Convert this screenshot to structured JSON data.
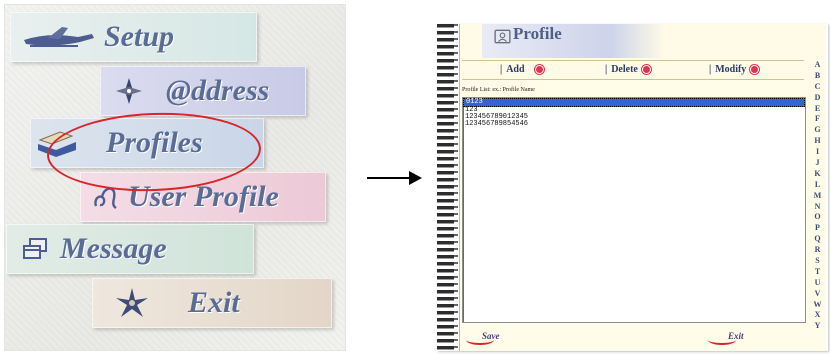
{
  "menu": {
    "items": [
      {
        "label": "Setup",
        "icon": "airplane-icon"
      },
      {
        "label": "@ddress",
        "icon": "compass-diamond-icon"
      },
      {
        "label": "Profiles",
        "icon": "tray-icon"
      },
      {
        "label": "User Profile",
        "icon": "leo-symbol-icon"
      },
      {
        "label": "Message",
        "icon": "windows-icon"
      },
      {
        "label": "Exit",
        "icon": "exit-star-icon"
      }
    ],
    "highlight_color": "#d8242a"
  },
  "profile_window": {
    "title": "Profile",
    "toolbar": {
      "add_label": "Add",
      "delete_label": "Delete",
      "modify_label": "Modify",
      "bar": "|"
    },
    "list_caption": "Profile List:     ex.: Profile Name",
    "list_items": [
      "0123",
      "123",
      "123456789012345",
      "123456789854546"
    ],
    "selected_item": "0123",
    "alphabet": [
      "A",
      "B",
      "C",
      "D",
      "E",
      "F",
      "G",
      "H",
      "I",
      "J",
      "K",
      "L",
      "M",
      "N",
      "O",
      "P",
      "Q",
      "R",
      "S",
      "T",
      "U",
      "V",
      "W",
      "X",
      "Y"
    ],
    "footer": {
      "save_label": "Save",
      "exit_label": "Exit"
    },
    "accent_color": "#2f66d4"
  }
}
